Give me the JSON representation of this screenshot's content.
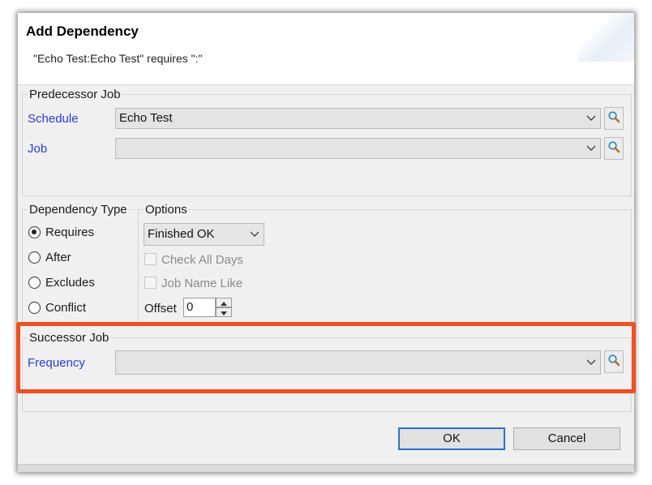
{
  "dialog": {
    "title": "Add Dependency",
    "subtitle": "\"Echo Test:Echo Test\" requires \":\""
  },
  "predecessor": {
    "legend": "Predecessor Job",
    "schedule_label": "Schedule",
    "schedule_value": "Echo Test",
    "job_label": "Job",
    "job_value": ""
  },
  "dependency_type": {
    "legend": "Dependency Type",
    "options": [
      "Requires",
      "After",
      "Excludes",
      "Conflict"
    ],
    "selected": "Requires"
  },
  "options": {
    "legend": "Options",
    "status_value": "Finished OK",
    "check_all_days_label": "Check All Days",
    "check_all_days_checked": false,
    "job_name_like_label": "Job Name Like",
    "job_name_like_checked": false,
    "offset_label": "Offset",
    "offset_value": "0"
  },
  "successor": {
    "legend": "Successor Job",
    "frequency_label": "Frequency",
    "frequency_value": ""
  },
  "buttons": {
    "ok": "OK",
    "cancel": "Cancel"
  },
  "colors": {
    "link": "#2a3bd6",
    "highlight": "#f0501f",
    "primary_border": "#2c72c7"
  },
  "icons": {
    "lookup": "magnifier-icon",
    "dropdown": "chevron-down-icon"
  }
}
